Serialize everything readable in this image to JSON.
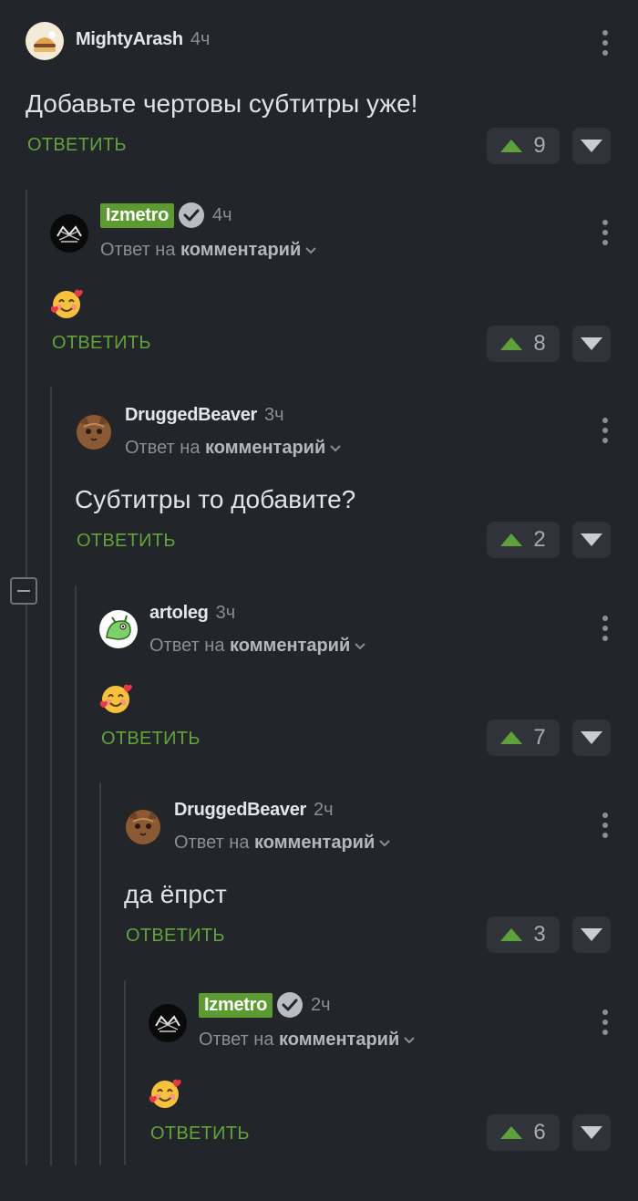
{
  "reply_label": "ОТВЕТИТЬ",
  "reply_to": {
    "prefix": "Ответ на",
    "target": "комментарий"
  },
  "colors": {
    "background": "#222529",
    "accent_green": "#62a33a",
    "badge_green": "#5d9a32",
    "muted": "#8a8f96"
  },
  "comments": [
    {
      "username": "MightyArash",
      "time": "4ч",
      "text": "Добавьте чертовы субтитры уже!",
      "emoji": "",
      "votes": "9",
      "badge": false,
      "verified": false,
      "reply_to": false,
      "avatar_icon": "burger-avatar"
    },
    {
      "username": "Izmetro",
      "time": "4ч",
      "text": "",
      "emoji": "smiling-face-with-hearts",
      "votes": "8",
      "badge": true,
      "verified": true,
      "reply_to": true,
      "avatar_icon": "metro-logo-avatar"
    },
    {
      "username": "DruggedBeaver",
      "time": "3ч",
      "text": "Субтитры то добавите?",
      "emoji": "",
      "votes": "2",
      "badge": false,
      "verified": false,
      "reply_to": true,
      "avatar_icon": "cat-avatar"
    },
    {
      "username": "artoleg",
      "time": "3ч",
      "text": "",
      "emoji": "smiling-face-with-hearts",
      "votes": "7",
      "badge": false,
      "verified": false,
      "reply_to": true,
      "avatar_icon": "green-creature-avatar"
    },
    {
      "username": "DruggedBeaver",
      "time": "2ч",
      "text": "да ёпрст",
      "emoji": "",
      "votes": "3",
      "badge": false,
      "verified": false,
      "reply_to": true,
      "avatar_icon": "cat-avatar"
    },
    {
      "username": "Izmetro",
      "time": "2ч",
      "text": "",
      "emoji": "smiling-face-with-hearts",
      "votes": "6",
      "badge": true,
      "verified": true,
      "reply_to": true,
      "avatar_icon": "metro-logo-avatar"
    }
  ]
}
